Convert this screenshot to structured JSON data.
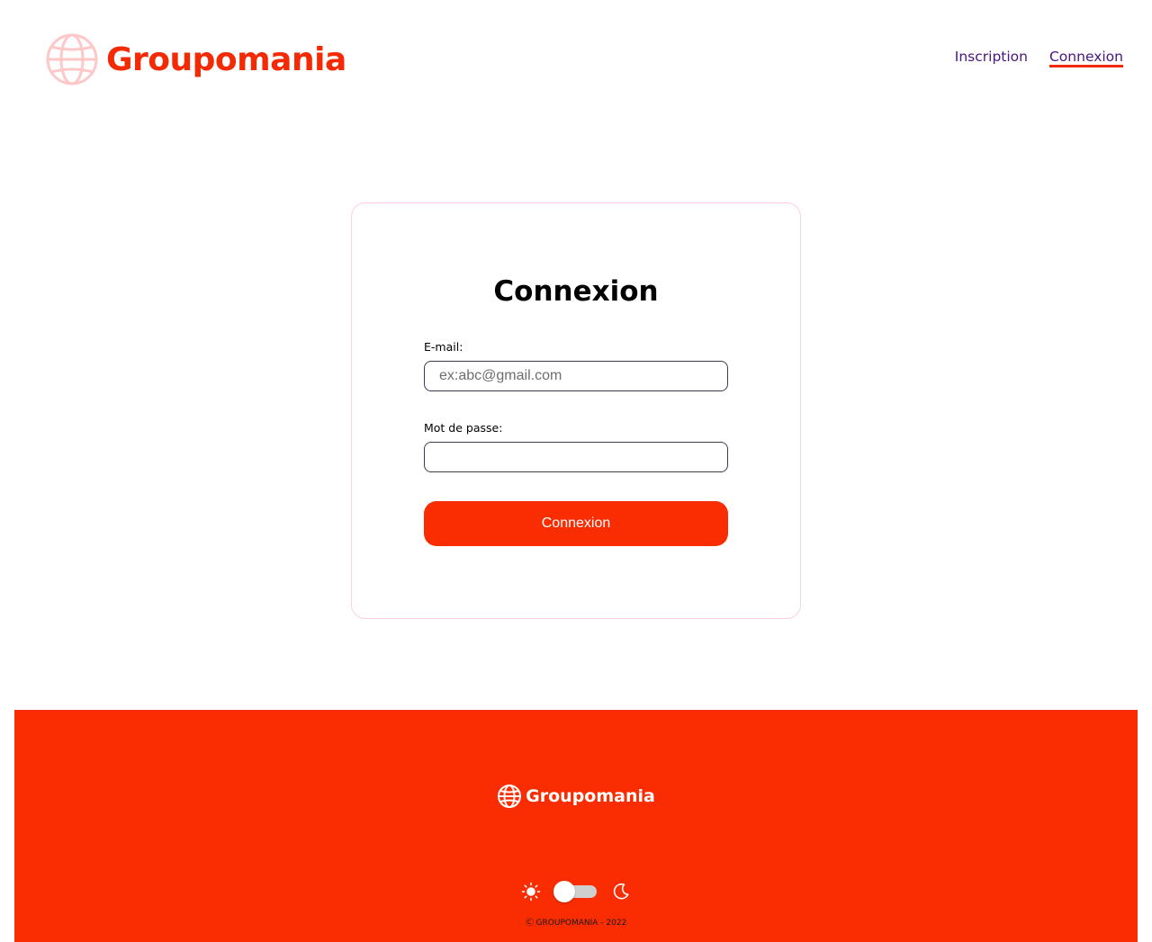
{
  "header": {
    "logo_text": "Groupomania",
    "logo_icon": "globe-icon",
    "nav": [
      {
        "label": "Inscription",
        "active": false
      },
      {
        "label": "Connexion",
        "active": true
      }
    ]
  },
  "login": {
    "title": "Connexion",
    "email_label": "E-mail:",
    "email_placeholder": "ex:abc@gmail.com",
    "email_value": "",
    "password_label": "Mot de passe:",
    "password_value": "",
    "submit_label": "Connexion"
  },
  "footer": {
    "logo_text": "Groupomania",
    "theme_toggle": {
      "light_icon": "sun-icon",
      "dark_icon": "moon-icon",
      "dark_mode": false
    },
    "copyright": "Ⓒ GROUPOMANIA - 2022"
  },
  "colors": {
    "brand": "#f92d01",
    "nav_text": "#4a1480",
    "card_border": "#ffd0da"
  }
}
